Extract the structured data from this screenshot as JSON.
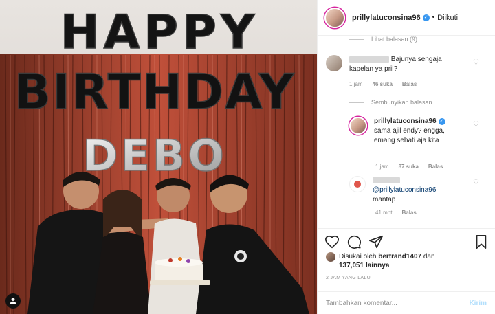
{
  "photo": {
    "balloons_top": "HAPPY",
    "balloons_mid": "BIRTHDAY",
    "balloons_name": "DEBO",
    "user_tag_icon": "person-icon"
  },
  "header": {
    "username": "prillylatuconsina96",
    "separator": "•",
    "follow_status": "Diikuti"
  },
  "comments": {
    "view_replies": "Lihat balasan (9)",
    "c1": {
      "text": "Bajunya sengaja kapelan ya pril?",
      "time": "1 jam",
      "likes": "46 suka",
      "reply": "Balas"
    },
    "hide_replies": "Sembunyikan balasan",
    "c2": {
      "username": "prillylatuconsina96",
      "text": "sama ajil endy? engga, emang sehati aja kita",
      "time": "1 jam",
      "likes": "87 suka",
      "reply": "Balas"
    },
    "c3": {
      "mention": "@prillylatuconsina96",
      "text": "mantap",
      "time": "41 mnt",
      "reply": "Balas"
    }
  },
  "actions": {
    "liked_prefix": "Disukai oleh",
    "liked_user": "bertrand1407",
    "liked_and": "dan",
    "liked_count": "137,051",
    "liked_others": "lainnya",
    "timestamp": "2 JAM YANG LALU"
  },
  "composer": {
    "placeholder": "Tambahkan komentar...",
    "send_label": "Kirim"
  },
  "colors": {
    "verified": "#3897f0",
    "send_disabled": "#b2dffc",
    "meta": "#8e8e8e"
  }
}
